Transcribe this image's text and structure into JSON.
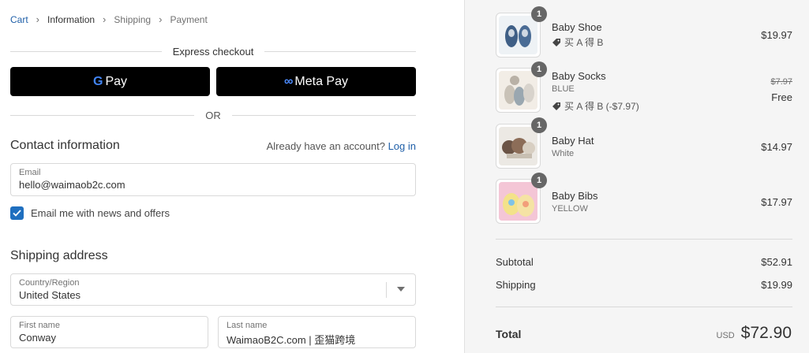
{
  "breadcrumb": {
    "cart": "Cart",
    "information": "Information",
    "shipping": "Shipping",
    "payment": "Payment",
    "separator_icon": "chevron-right-icon"
  },
  "express": {
    "label": "Express checkout",
    "gpay_label": "Pay",
    "gpay_g": "G",
    "metapay_logo": "∞",
    "metapay_label": "Meta Pay",
    "or_label": "OR"
  },
  "contact": {
    "title": "Contact information",
    "already_text": "Already have an account?",
    "login_label": "Log in",
    "email_label": "Email",
    "email_value": "hello@waimaob2c.com",
    "newsletter_label": "Email me with news and offers",
    "newsletter_checked": true
  },
  "shipping": {
    "title": "Shipping address",
    "country_label": "Country/Region",
    "country_value": "United States",
    "first_name_label": "First name",
    "first_name_value": "Conway",
    "last_name_label": "Last name",
    "last_name_value": "WaimaoB2C.com | 歪猫跨境"
  },
  "cart": {
    "items": [
      {
        "name": "Baby Shoe",
        "variant": "",
        "discount": "买 A 得 B",
        "price": "$19.97",
        "compare": "",
        "qty": "1"
      },
      {
        "name": "Baby Socks",
        "variant": "BLUE",
        "discount": "买 A 得 B (-$7.97)",
        "price": "Free",
        "compare": "$7.97",
        "qty": "1"
      },
      {
        "name": "Baby Hat",
        "variant": "White",
        "discount": "",
        "price": "$14.97",
        "compare": "",
        "qty": "1"
      },
      {
        "name": "Baby Bibs",
        "variant": "YELLOW",
        "discount": "",
        "price": "$17.97",
        "compare": "",
        "qty": "1"
      }
    ],
    "subtotal_label": "Subtotal",
    "subtotal_value": "$52.91",
    "shipping_label": "Shipping",
    "shipping_value": "$19.99",
    "total_label": "Total",
    "total_currency": "USD",
    "total_value": "$72.90"
  },
  "colors": {
    "link": "#1f5fa8",
    "checkbox": "#1f6fbf",
    "pay_button": "#000000",
    "summary_bg": "#f5f5f5"
  }
}
